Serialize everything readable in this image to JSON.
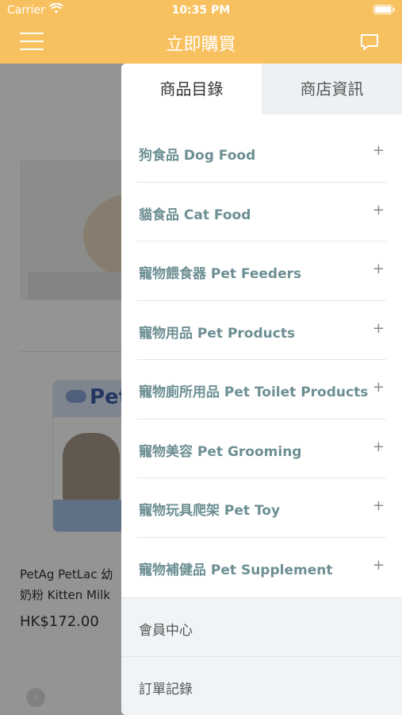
{
  "status_bar": {
    "carrier": "Carrier",
    "time": "10:35 PM"
  },
  "nav": {
    "title": "立即購買"
  },
  "background": {
    "product_name": "PetAg PetLac 幼貓奶粉 Kitten Milk",
    "product_name_line1": "PetAg PetLac 幼",
    "product_name_line2": "奶粉 Kitten Milk",
    "price": "HK$172.00",
    "package_brand": "Pet"
  },
  "drawer": {
    "tabs": [
      {
        "label": "商品目錄",
        "active": true
      },
      {
        "label": "商店資訊",
        "active": false
      }
    ],
    "categories": [
      {
        "label": "狗食品 Dog Food",
        "expand": "+"
      },
      {
        "label": "貓食品 Cat Food",
        "expand": "+"
      },
      {
        "label": "寵物餵食器 Pet Feeders",
        "expand": "+"
      },
      {
        "label": "寵物用品 Pet Products",
        "expand": "+"
      },
      {
        "label": "寵物廁所用品 Pet Toilet Products",
        "expand": "+"
      },
      {
        "label": "寵物美容 Pet Grooming",
        "expand": "+"
      },
      {
        "label": "寵物玩具爬架 Pet Toy",
        "expand": "+"
      },
      {
        "label": "寵物補健品 Pet Supplement",
        "expand": "+"
      }
    ],
    "member_links": [
      {
        "label": "會員中心"
      },
      {
        "label": "訂單記錄"
      }
    ]
  },
  "colors": {
    "accent": "#f8c160",
    "category_text": "#6d8f93",
    "inactive_tab": "#eef1f3"
  }
}
